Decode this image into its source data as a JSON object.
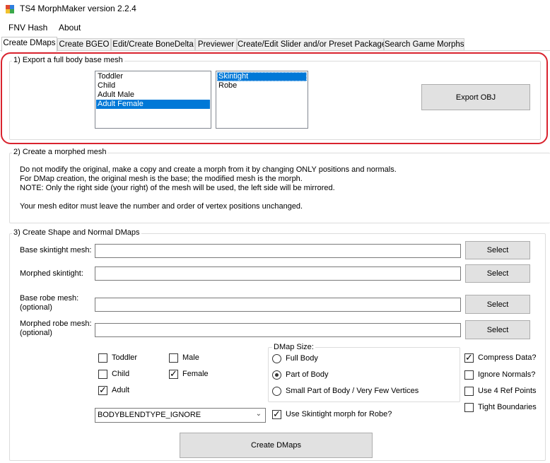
{
  "window": {
    "title": "TS4 MorphMaker version 2.2.4",
    "icon": "app-icon",
    "title_color": "#000000"
  },
  "menu": [
    "FNV Hash",
    "About"
  ],
  "tabs": [
    "Create DMaps",
    "Create BGEO",
    "Edit/Create BoneDelta",
    "Previewer",
    "Create/Edit Slider and/or Preset Package",
    "Search Game Morphs"
  ],
  "section1": {
    "title": "1) Export a full body base mesh",
    "ages": [
      "Toddler",
      "Child",
      "Adult Male",
      "Adult Female"
    ],
    "ages_selected": "Adult Female",
    "meshes": [
      "Skintight",
      "Robe"
    ],
    "meshes_selected": "Skintight",
    "export_button": "Export OBJ",
    "highlight_color": "#d9232e"
  },
  "section2": {
    "title": "2) Create a morphed mesh",
    "lines": [
      "Do not modify the original, make a copy and create a morph from it by changing ONLY positions and normals.",
      "For DMap creation, the original mesh is the base; the modified mesh is the morph.",
      "NOTE: Only the right side (your right) of the mesh will be used, the left side will be mirrored.",
      "Your mesh editor must leave the number and order of vertex positions unchanged."
    ]
  },
  "section3": {
    "title": "3) Create Shape and Normal DMaps",
    "fields": [
      {
        "label": "Base skintight mesh:",
        "sublabel": "",
        "value": "",
        "button": "Select"
      },
      {
        "label": "Morphed skintight:",
        "sublabel": "",
        "value": "",
        "button": "Select"
      },
      {
        "label": "Base robe mesh:",
        "sublabel": "(optional)",
        "value": "",
        "button": "Select"
      },
      {
        "label": "Morphed robe mesh:",
        "sublabel": "(optional)",
        "value": "",
        "button": "Select"
      }
    ],
    "age_checks": [
      {
        "label": "Toddler",
        "checked": false
      },
      {
        "label": "Child",
        "checked": false
      },
      {
        "label": "Adult",
        "checked": true
      }
    ],
    "gender_checks": [
      {
        "label": "Male",
        "checked": false
      },
      {
        "label": "Female",
        "checked": true
      }
    ],
    "dmap_size": {
      "title": "DMap Size:",
      "options": [
        "Full Body",
        "Part of Body",
        "Small Part of Body / Very Few Vertices"
      ],
      "selected": "Part of Body"
    },
    "options": [
      {
        "label": "Compress Data?",
        "checked": true
      },
      {
        "label": "Ignore Normals?",
        "checked": false
      },
      {
        "label": "Use 4 Ref Points",
        "checked": false
      },
      {
        "label": "Tight Boundaries",
        "checked": false
      }
    ],
    "blend_type": "BODYBLENDTYPE_IGNORE",
    "use_skintight_for_robe": {
      "label": "Use Skintight morph for Robe?",
      "checked": true
    },
    "create_button": "Create DMaps"
  }
}
